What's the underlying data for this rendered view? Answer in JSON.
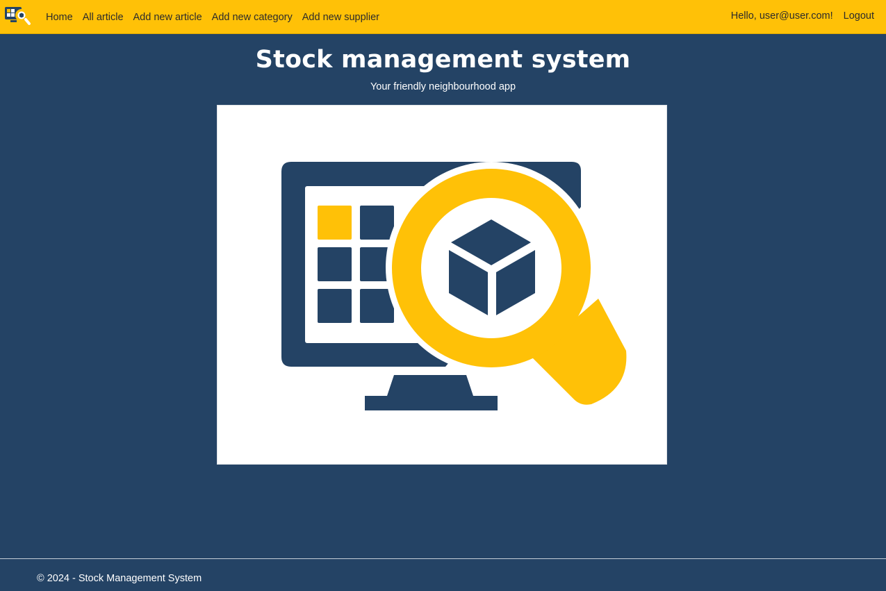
{
  "nav": {
    "links": [
      "Home",
      "All article",
      "Add new article",
      "Add new category",
      "Add new supplier"
    ],
    "greeting": "Hello, user@user.com!",
    "logout": "Logout"
  },
  "hero": {
    "title": "Stock management system",
    "subtitle": "Your friendly neighbourhood app",
    "image_icon": "monitor-magnifier-box-illustration"
  },
  "footer": {
    "text": "© 2024 - Stock Management System"
  },
  "colors": {
    "primary_navbar": "#ffc107",
    "background": "#244365",
    "text_light": "#ffffff"
  }
}
